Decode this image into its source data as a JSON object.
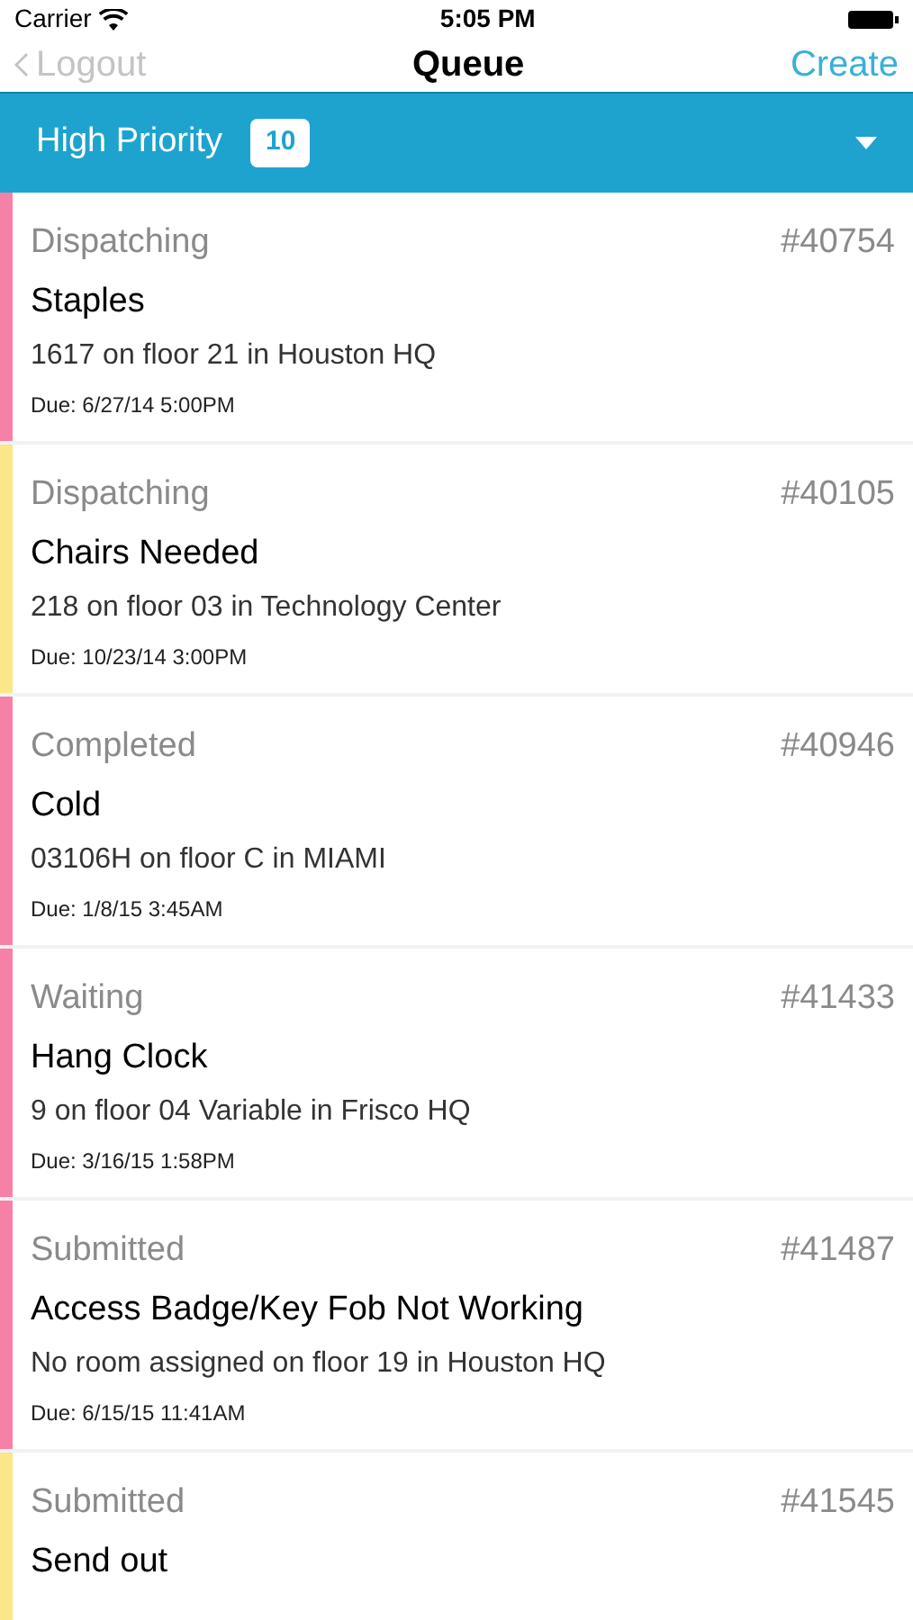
{
  "status_bar": {
    "carrier": "Carrier",
    "time": "5:05 PM"
  },
  "nav": {
    "back": "Logout",
    "title": "Queue",
    "action": "Create"
  },
  "filter": {
    "label": "High Priority",
    "count": "10"
  },
  "tickets": [
    {
      "status": "Dispatching",
      "number": "#40754",
      "title": "Staples",
      "location": "1617 on floor 21 in Houston HQ",
      "due": "Due: 6/27/14 5:00PM",
      "color": "#f780a6"
    },
    {
      "status": "Dispatching",
      "number": "#40105",
      "title": "Chairs Needed",
      "location": "218 on floor 03 in Technology Center",
      "due": "Due: 10/23/14 3:00PM",
      "color": "#fbe688"
    },
    {
      "status": "Completed",
      "number": "#40946",
      "title": "Cold",
      "location": "03106H on floor C in MIAMI",
      "due": "Due: 1/8/15 3:45AM",
      "color": "#f780a6"
    },
    {
      "status": "Waiting",
      "number": "#41433",
      "title": "Hang Clock",
      "location": "9 on floor 04 Variable in Frisco HQ",
      "due": "Due: 3/16/15 1:58PM",
      "color": "#f780a6"
    },
    {
      "status": "Submitted",
      "number": "#41487",
      "title": "Access Badge/Key Fob Not Working",
      "location": "No room assigned on floor 19 in Houston HQ",
      "due": "Due: 6/15/15 11:41AM",
      "color": "#f780a6"
    },
    {
      "status": "Submitted",
      "number": "#41545",
      "title": "Send out",
      "color": "#fbe688"
    }
  ]
}
